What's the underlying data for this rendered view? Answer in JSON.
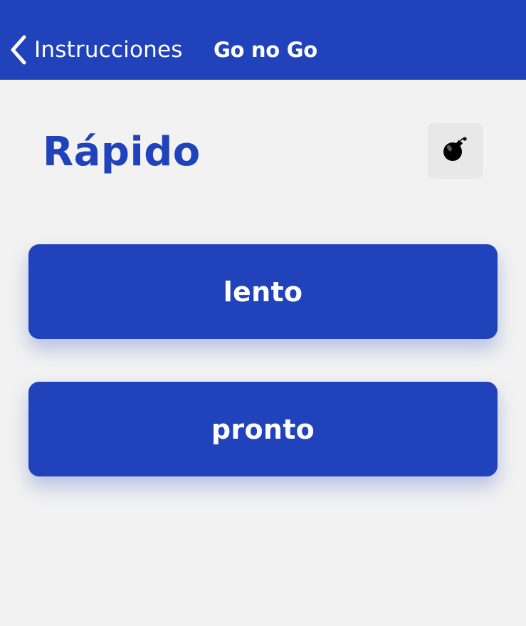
{
  "navbar": {
    "back_label": "Instrucciones",
    "back_icon": "chevron-left-icon",
    "title": "Go no Go",
    "background": "#2042bb"
  },
  "main": {
    "heading": "Rápido",
    "action_icon": "bomb-icon",
    "options": [
      {
        "label": "lento"
      },
      {
        "label": "pronto"
      }
    ]
  },
  "colors": {
    "accent": "#2042bb",
    "page_background": "#f2f2f2",
    "icon_button_background": "#e8e8e8",
    "button_text": "#ffffff"
  }
}
